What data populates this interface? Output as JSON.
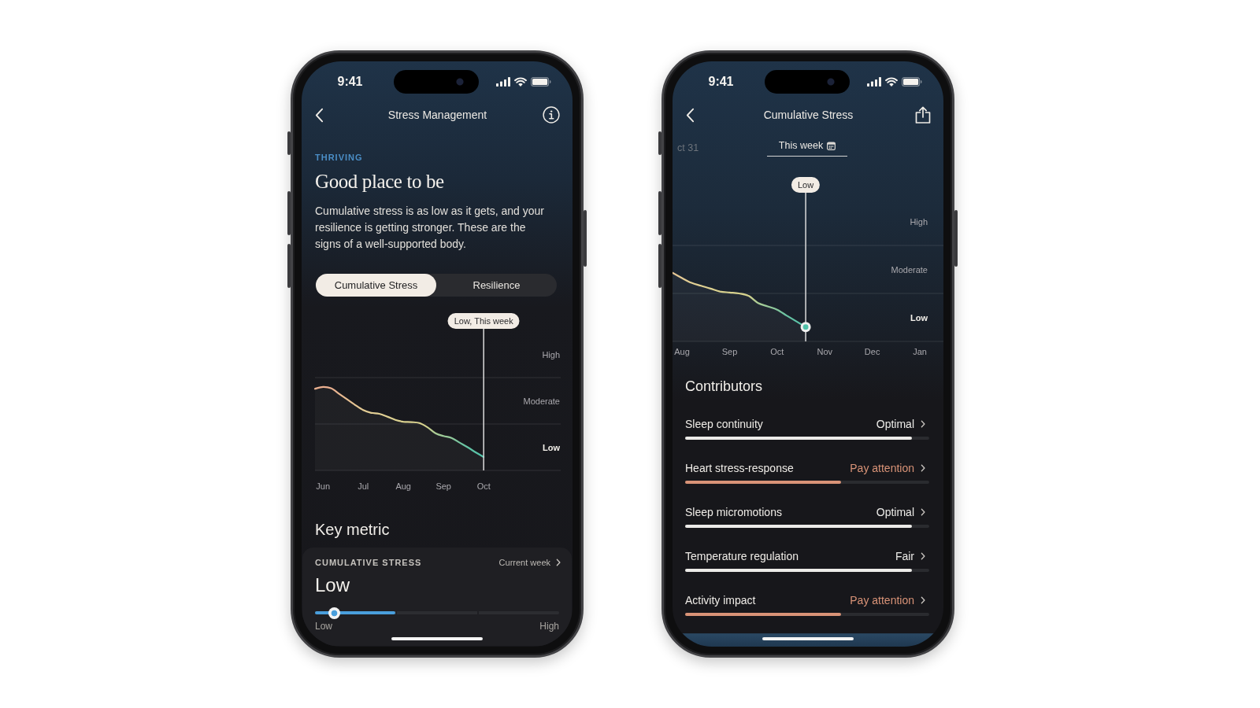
{
  "screens": [
    {
      "kind": "stress_management",
      "status_bar": {
        "time": "9:41"
      },
      "header": {
        "title": "Stress Management"
      },
      "eyebrow": "THRIVING",
      "headline": "Good place to be",
      "summary": "Cumulative stress is as low as it gets, and your resilience is getting stronger. These are the signs of a well-supported body.",
      "segments": [
        {
          "label": "Cumulative Stress",
          "selected": true
        },
        {
          "label": "Resilience",
          "selected": false
        }
      ],
      "chart": {
        "tooltip": "Low, This week",
        "level_labels": [
          {
            "label": "High",
            "selected": false
          },
          {
            "label": "Moderate",
            "selected": false
          },
          {
            "label": "Low",
            "selected": true
          }
        ],
        "month_labels": [
          "Jun",
          "Jul",
          "Aug",
          "Sep",
          "Oct"
        ]
      },
      "key_metric": {
        "heading": "Key metric",
        "label": "CUMULATIVE STRESS",
        "period": "Current week",
        "value": "Low",
        "level": 0.08,
        "min_label": "Low",
        "max_label": "High"
      }
    },
    {
      "kind": "cumulative_stress_detail",
      "status_bar": {
        "time": "9:41"
      },
      "header": {
        "title": "Cumulative Stress"
      },
      "date_tabs": [
        {
          "label": "ct 31",
          "selected": false
        },
        {
          "label": "This week",
          "selected": true
        }
      ],
      "chart": {
        "tooltip": "Low",
        "level_labels": [
          {
            "label": "High",
            "selected": false
          },
          {
            "label": "Moderate",
            "selected": false
          },
          {
            "label": "Low",
            "selected": true
          }
        ],
        "month_labels": [
          "Aug",
          "Sep",
          "Oct",
          "Nov",
          "Dec",
          "Jan"
        ]
      },
      "contributors": {
        "heading": "Contributors",
        "items": [
          {
            "name": "Sleep continuity",
            "status": "Optimal",
            "color": "#ecebe8",
            "level": 0.93
          },
          {
            "name": "Heart stress-response",
            "status": "Pay attention",
            "color": "#d99377",
            "level": 0.64
          },
          {
            "name": "Sleep micromotions",
            "status": "Optimal",
            "color": "#ecebe8",
            "level": 0.93
          },
          {
            "name": "Temperature regulation",
            "status": "Fair",
            "color": "#ecebe8",
            "level": 0.93
          },
          {
            "name": "Activity impact",
            "status": "Pay attention",
            "color": "#d99377",
            "level": 0.64
          }
        ]
      }
    }
  ]
}
